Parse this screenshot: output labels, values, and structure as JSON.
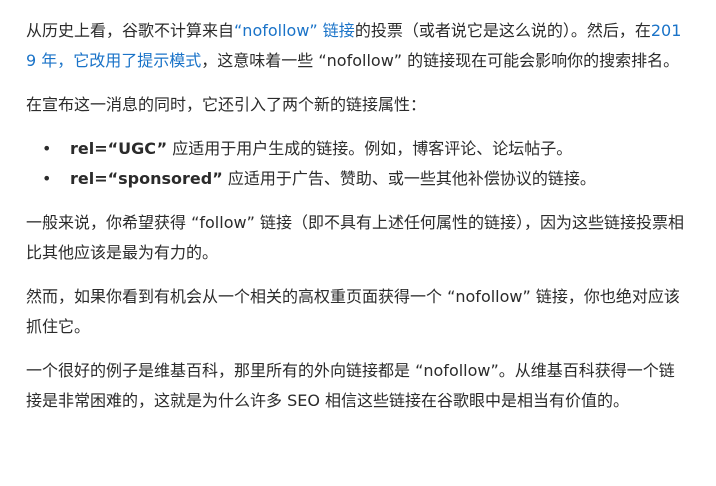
{
  "article": {
    "p1": {
      "t1": "从历史上看，谷歌不计算来自",
      "link1": "“nofollow” 链接",
      "t2": "的投票（或者说它是这么说的）。然后，在",
      "link2": "2019 年，它改用了提示模式",
      "t3": "，这意味着一些 “nofollow” 的链接现在可能会影响你的搜索排名。"
    },
    "p2": "在宣布这一消息的同时，它还引入了两个新的链接属性：",
    "bullets": [
      {
        "marker": "•",
        "label": "rel=“UGC”",
        "text": " 应适用于用户生成的链接。例如，博客评论、论坛帖子。"
      },
      {
        "marker": "•",
        "label": "rel=“sponsored”",
        "text": " 应适用于广告、赞助、或一些其他补偿协议的链接。"
      }
    ],
    "p3": "一般来说，你希望获得 “follow” 链接（即不具有上述任何属性的链接），因为这些链接投票相比其他应该是最为有力的。",
    "p4": "然而，如果你看到有机会从一个相关的高权重页面获得一个 “nofollow” 链接，你也绝对应该抓住它。",
    "p5": "一个很好的例子是维基百科，那里所有的外向链接都是 “nofollow”。从维基百科获得一个链接是非常困难的，这就是为什么许多 SEO 相信这些链接在谷歌眼中是相当有价值的。"
  },
  "colors": {
    "text": "#2b2b2b",
    "link": "#1a73c8",
    "background": "#ffffff"
  }
}
